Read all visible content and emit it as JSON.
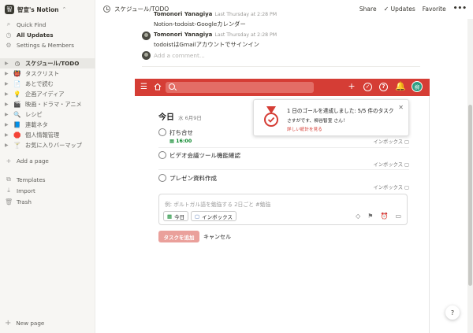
{
  "workspace": {
    "name": "智宣's Notion",
    "avatar": "智"
  },
  "sidebar": {
    "nav": [
      {
        "label": "Quick Find",
        "icon": "search-icon"
      },
      {
        "label": "All Updates",
        "icon": "clock-icon"
      },
      {
        "label": "Settings & Members",
        "icon": "gear-icon"
      }
    ],
    "pages": [
      {
        "label": "スケジュール/TODO",
        "emoji": "◷",
        "active": true
      },
      {
        "label": "タスクリスト",
        "emoji": "👹"
      },
      {
        "label": "あとで読む",
        "emoji": "📄"
      },
      {
        "label": "企画アイディア",
        "emoji": "💡"
      },
      {
        "label": "映画・ドラマ・アニメ",
        "emoji": "🎬"
      },
      {
        "label": "レシピ",
        "emoji": "🔍"
      },
      {
        "label": "連載ネタ",
        "emoji": "📘"
      },
      {
        "label": "個人情報管理",
        "emoji": "🛑"
      },
      {
        "label": "お気に入りバーマップ",
        "emoji": "🍸"
      }
    ],
    "add_page": "Add a page",
    "footer": [
      {
        "label": "Templates",
        "icon": "template-icon"
      },
      {
        "label": "Import",
        "icon": "download-icon"
      },
      {
        "label": "Trash",
        "icon": "trash-icon"
      }
    ],
    "new_page": "New page"
  },
  "topbar": {
    "breadcrumb": "スケジュール/TODO",
    "share": "Share",
    "updates": "Updates",
    "favorite": "Favorite",
    "more": "•••"
  },
  "comments": {
    "items": [
      {
        "author": "Tomonori Yanagiya",
        "time": "Last Thursday at 2:28 PM",
        "text": "Notion-todoist-Googleカレンダー"
      },
      {
        "author": "Tomonori Yanagiya",
        "time": "Last Thursday at 2:28 PM",
        "text": "todoistはGmailアカウントでサインイン"
      }
    ],
    "placeholder": "Add a comment..."
  },
  "todoist": {
    "brand_color": "#d53d35",
    "avatar": "柳",
    "view_title": "今日",
    "view_date": "水 6月9日",
    "tasks": [
      {
        "name": "打ち合せ",
        "due": "16:00",
        "project": "インボックス"
      },
      {
        "name": "ビデオ会議ツール機能確認",
        "due": "",
        "project": "インボックス"
      },
      {
        "name": "プレゼン資料作成",
        "due": "",
        "project": "インボックス"
      }
    ],
    "editor": {
      "placeholder": "例: ポルトガル語を勉強する 2日ごと #勉強",
      "date_chip": "今日",
      "project_chip": "インボックス"
    },
    "add_button": "タスクを追加",
    "cancel_button": "キャンセル",
    "toast": {
      "title": "1 日のゴールを達成しました: 5/5 件のタスク",
      "subtitle": "さすがです、柳谷智宣 さん！",
      "link": "詳しい統計を見る"
    }
  }
}
